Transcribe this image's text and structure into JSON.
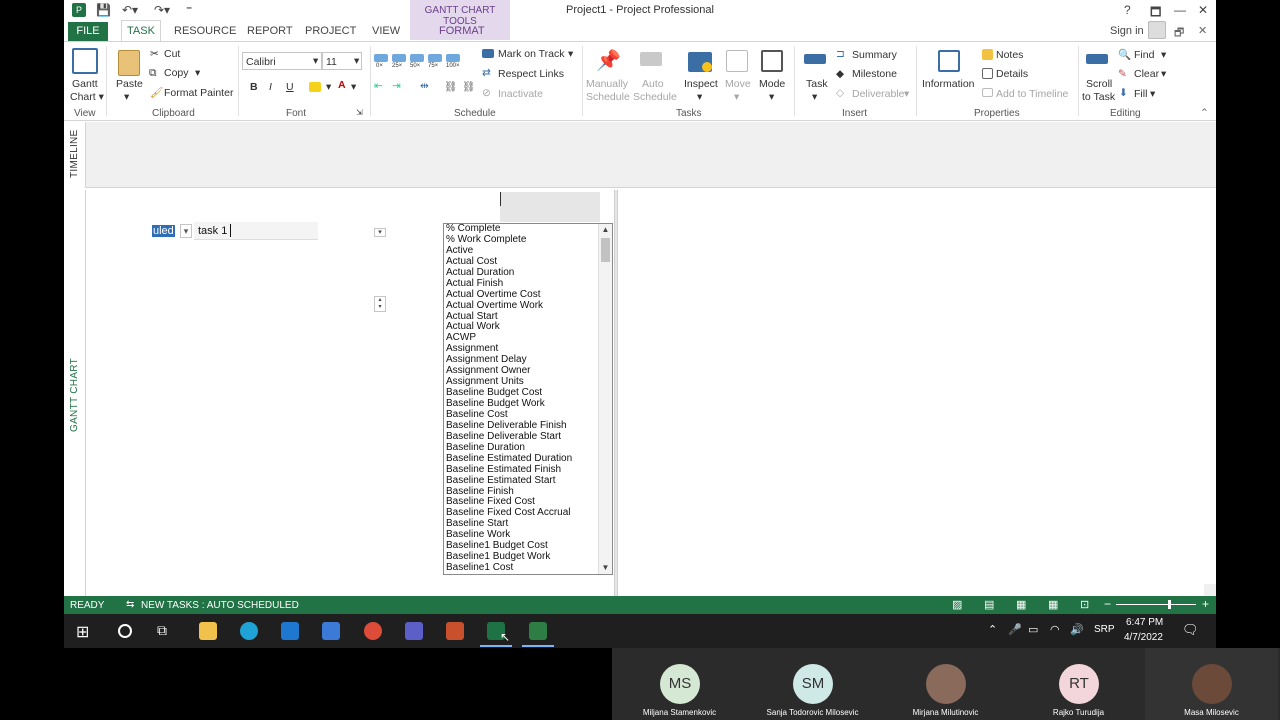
{
  "window": {
    "title": "Project1 - Project Professional",
    "context_group": "GANTT CHART TOOLS",
    "help": "?",
    "sign_in": "Sign in",
    "minimize": "—",
    "restore": "🗗",
    "close": "✕"
  },
  "tabs": [
    "FILE",
    "TASK",
    "RESOURCE",
    "REPORT",
    "PROJECT",
    "VIEW",
    "FORMAT"
  ],
  "active_tab": "TASK",
  "ribbon": {
    "view": {
      "gantt": "Gantt",
      "chart": "Chart ▾",
      "label": "View"
    },
    "clipboard": {
      "paste": "Paste",
      "cut": "Cut",
      "copy": "Copy",
      "format_painter": "Format Painter",
      "label": "Clipboard"
    },
    "font": {
      "family": "Calibri",
      "size": "11",
      "bold": "B",
      "italic": "I",
      "underline": "U",
      "label": "Font"
    },
    "schedule": {
      "pct": [
        "0×",
        "25×",
        "50×",
        "75×",
        "100×"
      ],
      "mark_on_track": "Mark on Track",
      "respect_links": "Respect Links",
      "inactivate": "Inactivate",
      "label": "Schedule"
    },
    "tasks": {
      "manually": "Manually",
      "manually2": "Schedule",
      "auto": "Auto",
      "auto2": "Schedule",
      "inspect": "Inspect",
      "move": "Move",
      "mode": "Mode",
      "label": "Tasks"
    },
    "insert": {
      "task": "Task",
      "summary": "Summary",
      "milestone": "Milestone",
      "deliverable": "Deliverable",
      "label": "Insert"
    },
    "properties": {
      "information": "Information",
      "notes": "Notes",
      "details": "Details",
      "add_to_timeline": "Add to Timeline",
      "label": "Properties"
    },
    "editing": {
      "scroll": "Scroll",
      "scroll2": "to Task",
      "find": "Find",
      "clear": "Clear",
      "fill": "Fill",
      "label": "Editing"
    }
  },
  "timeline_label": "TIMELINE",
  "gantt_label": "GANTT CHART",
  "editor": {
    "mode_value": "uled",
    "task_value": "task 1"
  },
  "field_list": [
    "% Complete",
    "% Work Complete",
    "Active",
    "Actual Cost",
    "Actual Duration",
    "Actual Finish",
    "Actual Overtime Cost",
    "Actual Overtime Work",
    "Actual Start",
    "Actual Work",
    "ACWP",
    "Assignment",
    "Assignment Delay",
    "Assignment Owner",
    "Assignment Units",
    "Baseline Budget Cost",
    "Baseline Budget Work",
    "Baseline Cost",
    "Baseline Deliverable Finish",
    "Baseline Deliverable Start",
    "Baseline Duration",
    "Baseline Estimated Duration",
    "Baseline Estimated Finish",
    "Baseline Estimated Start",
    "Baseline Finish",
    "Baseline Fixed Cost",
    "Baseline Fixed Cost Accrual",
    "Baseline Start",
    "Baseline Work",
    "Baseline1 Budget Cost",
    "Baseline1 Budget Work",
    "Baseline1 Cost"
  ],
  "status": {
    "ready": "READY",
    "new_tasks": "NEW TASKS : AUTO SCHEDULED"
  },
  "taskbar": {
    "lang": "SRP",
    "time": "6:47 PM",
    "date": "4/7/2022"
  },
  "participants": [
    {
      "initials": "MS",
      "name": "Miljana Stamenkovic",
      "color": "#d5e8d4"
    },
    {
      "initials": "SM",
      "name": "Sanja Todorovic Milosevic",
      "color": "#cfe9e6"
    },
    {
      "initials": "",
      "name": "Mirjana Milutinovic",
      "color": "#8a6a5a"
    },
    {
      "initials": "RT",
      "name": "Rajko Turudija",
      "color": "#f3d6dc"
    },
    {
      "initials": "",
      "name": "Masa Milosevic",
      "color": "#6b4a3a"
    }
  ]
}
